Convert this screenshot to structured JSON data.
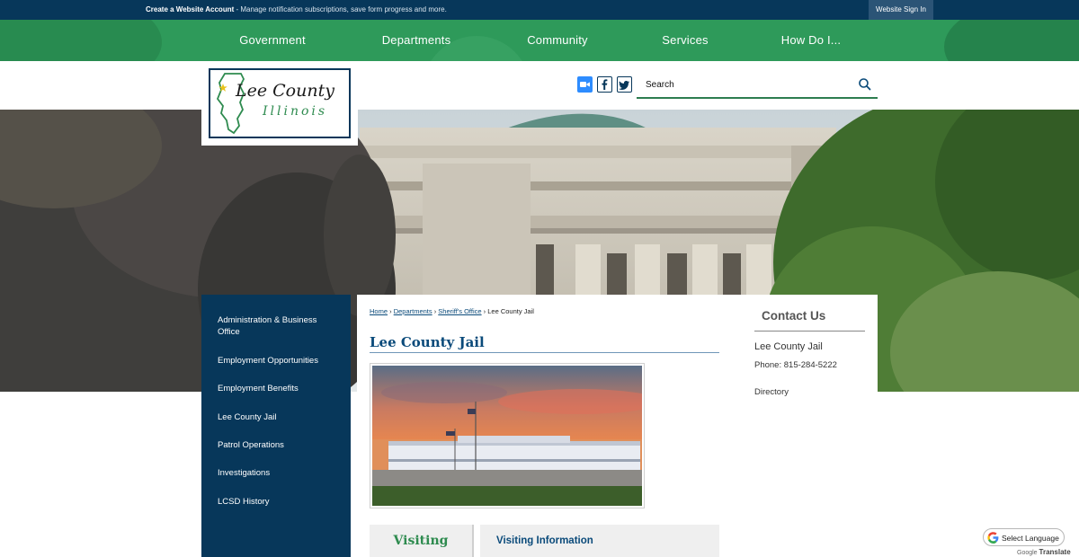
{
  "topbar": {
    "account_link": "Create a Website Account",
    "account_desc": " - Manage notification subscriptions, save form progress and more.",
    "signin": "Website Sign In"
  },
  "nav": {
    "items": [
      "Government",
      "Departments",
      "Community",
      "Services",
      "How Do I..."
    ]
  },
  "logo": {
    "line1": "Lee County",
    "line2": "Illinois"
  },
  "social": {
    "icons": [
      "zoom-icon",
      "facebook-icon",
      "twitter-icon"
    ],
    "colors": {
      "zoom": "#2d8cff",
      "brand_navy": "#07375a"
    }
  },
  "search": {
    "placeholder": "Search"
  },
  "sidebar": {
    "items": [
      {
        "label": "Administration & Business Office"
      },
      {
        "label": "Employment Opportunities"
      },
      {
        "label": "Employment Benefits"
      },
      {
        "label": "Lee County Jail"
      },
      {
        "label": "Patrol Operations"
      },
      {
        "label": "Investigations"
      },
      {
        "label": "LCSD History"
      }
    ]
  },
  "breadcrumb": {
    "home": "Home",
    "departments": "Departments",
    "sheriff": "Sheriff's Office",
    "current": "Lee County Jail",
    "sep": " › "
  },
  "page": {
    "title": "Lee County Jail"
  },
  "tabs": {
    "visiting": "Visiting",
    "visiting_info": "Visiting Information"
  },
  "contact": {
    "title": "Contact Us",
    "name": "Lee County Jail",
    "phone": "Phone: 815-284-5222",
    "directory": "Directory"
  },
  "translate": {
    "label": "Select Language",
    "powered_prefix": "Google",
    "powered_word": "Translate"
  },
  "colors": {
    "nav_green": "#2e9a5a",
    "top_navy": "#07375a",
    "title_blue": "#0a4a7a",
    "visiting_green": "#2e8b4f"
  }
}
